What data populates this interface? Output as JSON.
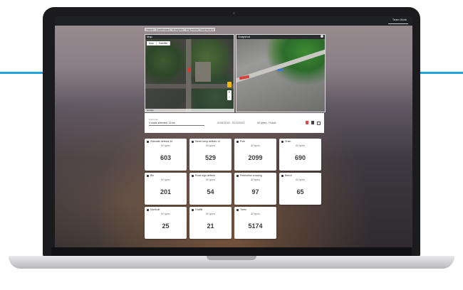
{
  "colors": {
    "accent_line": "#1ea5e0",
    "card_bg": "#ffffff",
    "topbar": "#1e2024"
  },
  "topbar": {
    "user": "Team Work"
  },
  "breadcrumb": "Home / Dashboard / Analytics / Inspection Dashboard",
  "map_panel": {
    "title": "Map",
    "toggle": [
      "Map",
      "Satellite"
    ],
    "footer": "Google"
  },
  "snap_panel": {
    "title": "Snapshot"
  },
  "filter": {
    "input_label": "Select area",
    "input_value": "3 roads selected, 24 km",
    "date": "01/01/2024 - 31/12/2024",
    "type": "All types - Roads",
    "icons": [
      "pdf-icon",
      "table-icon",
      "settings-icon"
    ]
  },
  "cards": [
    {
      "label": "Sidewalk defects 44",
      "sub": "All types",
      "value": "603",
      "icon": "crack-icon"
    },
    {
      "label": "Street lamp defects 12",
      "sub": "All types",
      "value": "529",
      "icon": "lamp-icon"
    },
    {
      "label": "Pole",
      "sub": "All types",
      "value": "2099",
      "icon": "pole-icon"
    },
    {
      "label": "Drain",
      "sub": "All types",
      "value": "690",
      "icon": "drain-icon"
    },
    {
      "label": "Bin",
      "sub": "All types",
      "value": "201",
      "icon": "bin-icon"
    },
    {
      "label": "Road sign defects",
      "sub": "All types",
      "value": "54",
      "icon": "sign-icon"
    },
    {
      "label": "Pedestrian crossing",
      "sub": "All types",
      "value": "97",
      "icon": "crossing-icon"
    },
    {
      "label": "Bench",
      "sub": "All types",
      "value": "65",
      "icon": "bench-icon"
    },
    {
      "label": "Manhole",
      "sub": "All types",
      "value": "25",
      "icon": "manhole-icon"
    },
    {
      "label": "Graffiti",
      "sub": "All types",
      "value": "21",
      "icon": "graffiti-icon"
    },
    {
      "label": "Trees",
      "sub": "All types",
      "value": "5174",
      "icon": "tree-icon"
    }
  ]
}
